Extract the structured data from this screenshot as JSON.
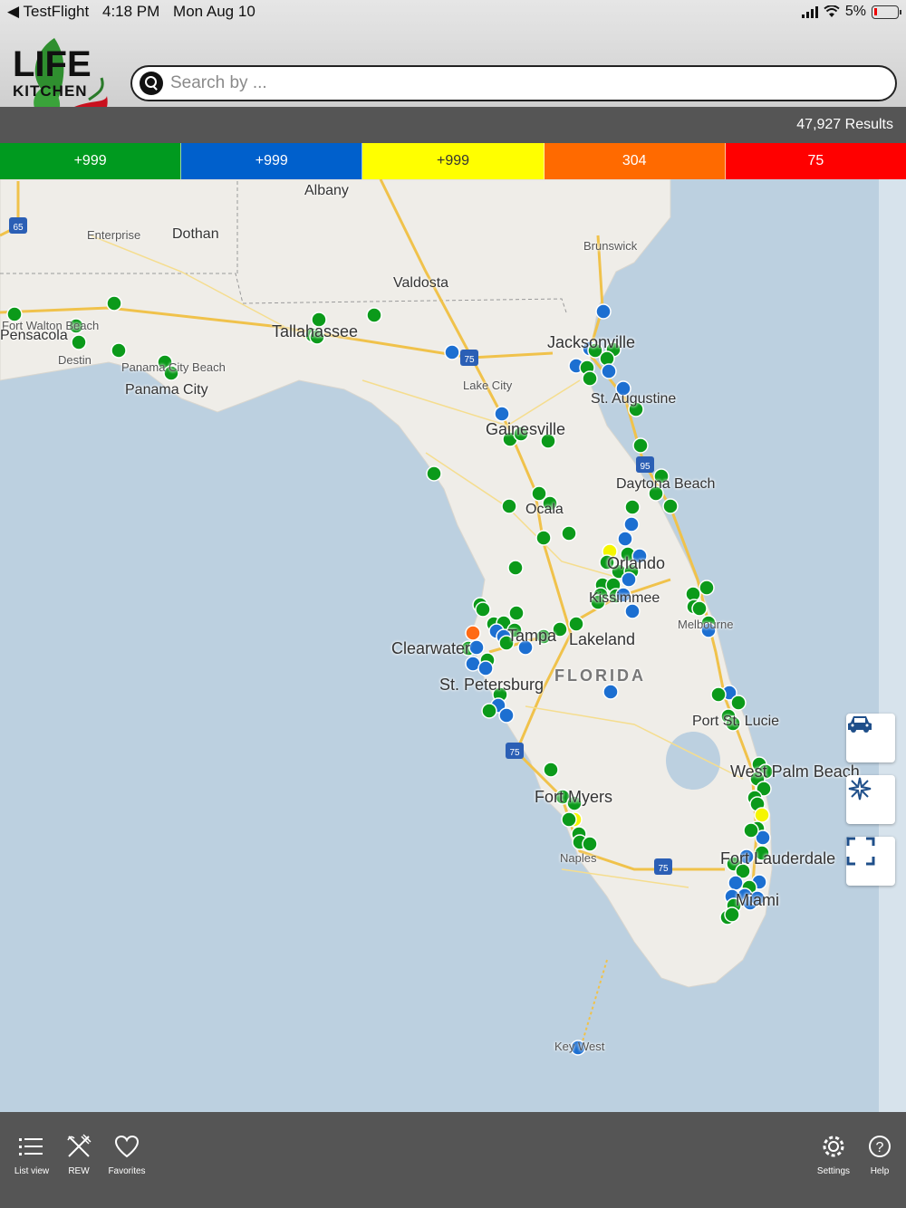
{
  "status_bar": {
    "back_app": "◀ TestFlight",
    "time": "4:18 PM",
    "date": "Mon Aug 10",
    "battery": "5%"
  },
  "brand": {
    "logo_line1": "LIFE",
    "logo_line2": "KITCHEN"
  },
  "search": {
    "placeholder": "Search by ...",
    "value": ""
  },
  "results": {
    "count_text": "47,927 Results"
  },
  "filters": [
    {
      "label": "+999",
      "color": "#009a1f"
    },
    {
      "label": "+999",
      "color": "#0060cc"
    },
    {
      "label": "+999",
      "color": "#ffff00"
    },
    {
      "label": "304",
      "color": "#ff6a00"
    },
    {
      "label": "75",
      "color": "#ff0000"
    }
  ],
  "map": {
    "state_label": "FLORIDA",
    "places": [
      "Albany",
      "Dothan",
      "Enterprise",
      "Brunswick",
      "Valdosta",
      "Tallahassee",
      "Jacksonville",
      "Lake City",
      "St. Augustine",
      "Gainesville",
      "Daytona Beach",
      "Ocala",
      "Orlando",
      "Kissimmee",
      "Melbourne",
      "Clearwater",
      "Tampa",
      "Lakeland",
      "St. Petersburg",
      "Port St. Lucie",
      "West Palm Beach",
      "Fort Myers",
      "Naples",
      "Fort Lauderdale",
      "Miami",
      "Key West",
      "Panama City",
      "Panama City Beach",
      "Destin",
      "Fort Walton Beach",
      "Pensacola"
    ],
    "highway_shields": [
      "65",
      "75",
      "95"
    ],
    "controls": [
      "car-icon",
      "recenter-icon",
      "fullscreen-icon"
    ]
  },
  "tabbar": {
    "left": [
      {
        "label": "List view",
        "icon": "list-icon"
      },
      {
        "label": "REW",
        "icon": "fork-knife-icon"
      },
      {
        "label": "Favorites",
        "icon": "heart-icon"
      }
    ],
    "right": [
      {
        "label": "Settings",
        "icon": "gear-icon"
      },
      {
        "label": "Help",
        "icon": "help-icon"
      }
    ]
  }
}
